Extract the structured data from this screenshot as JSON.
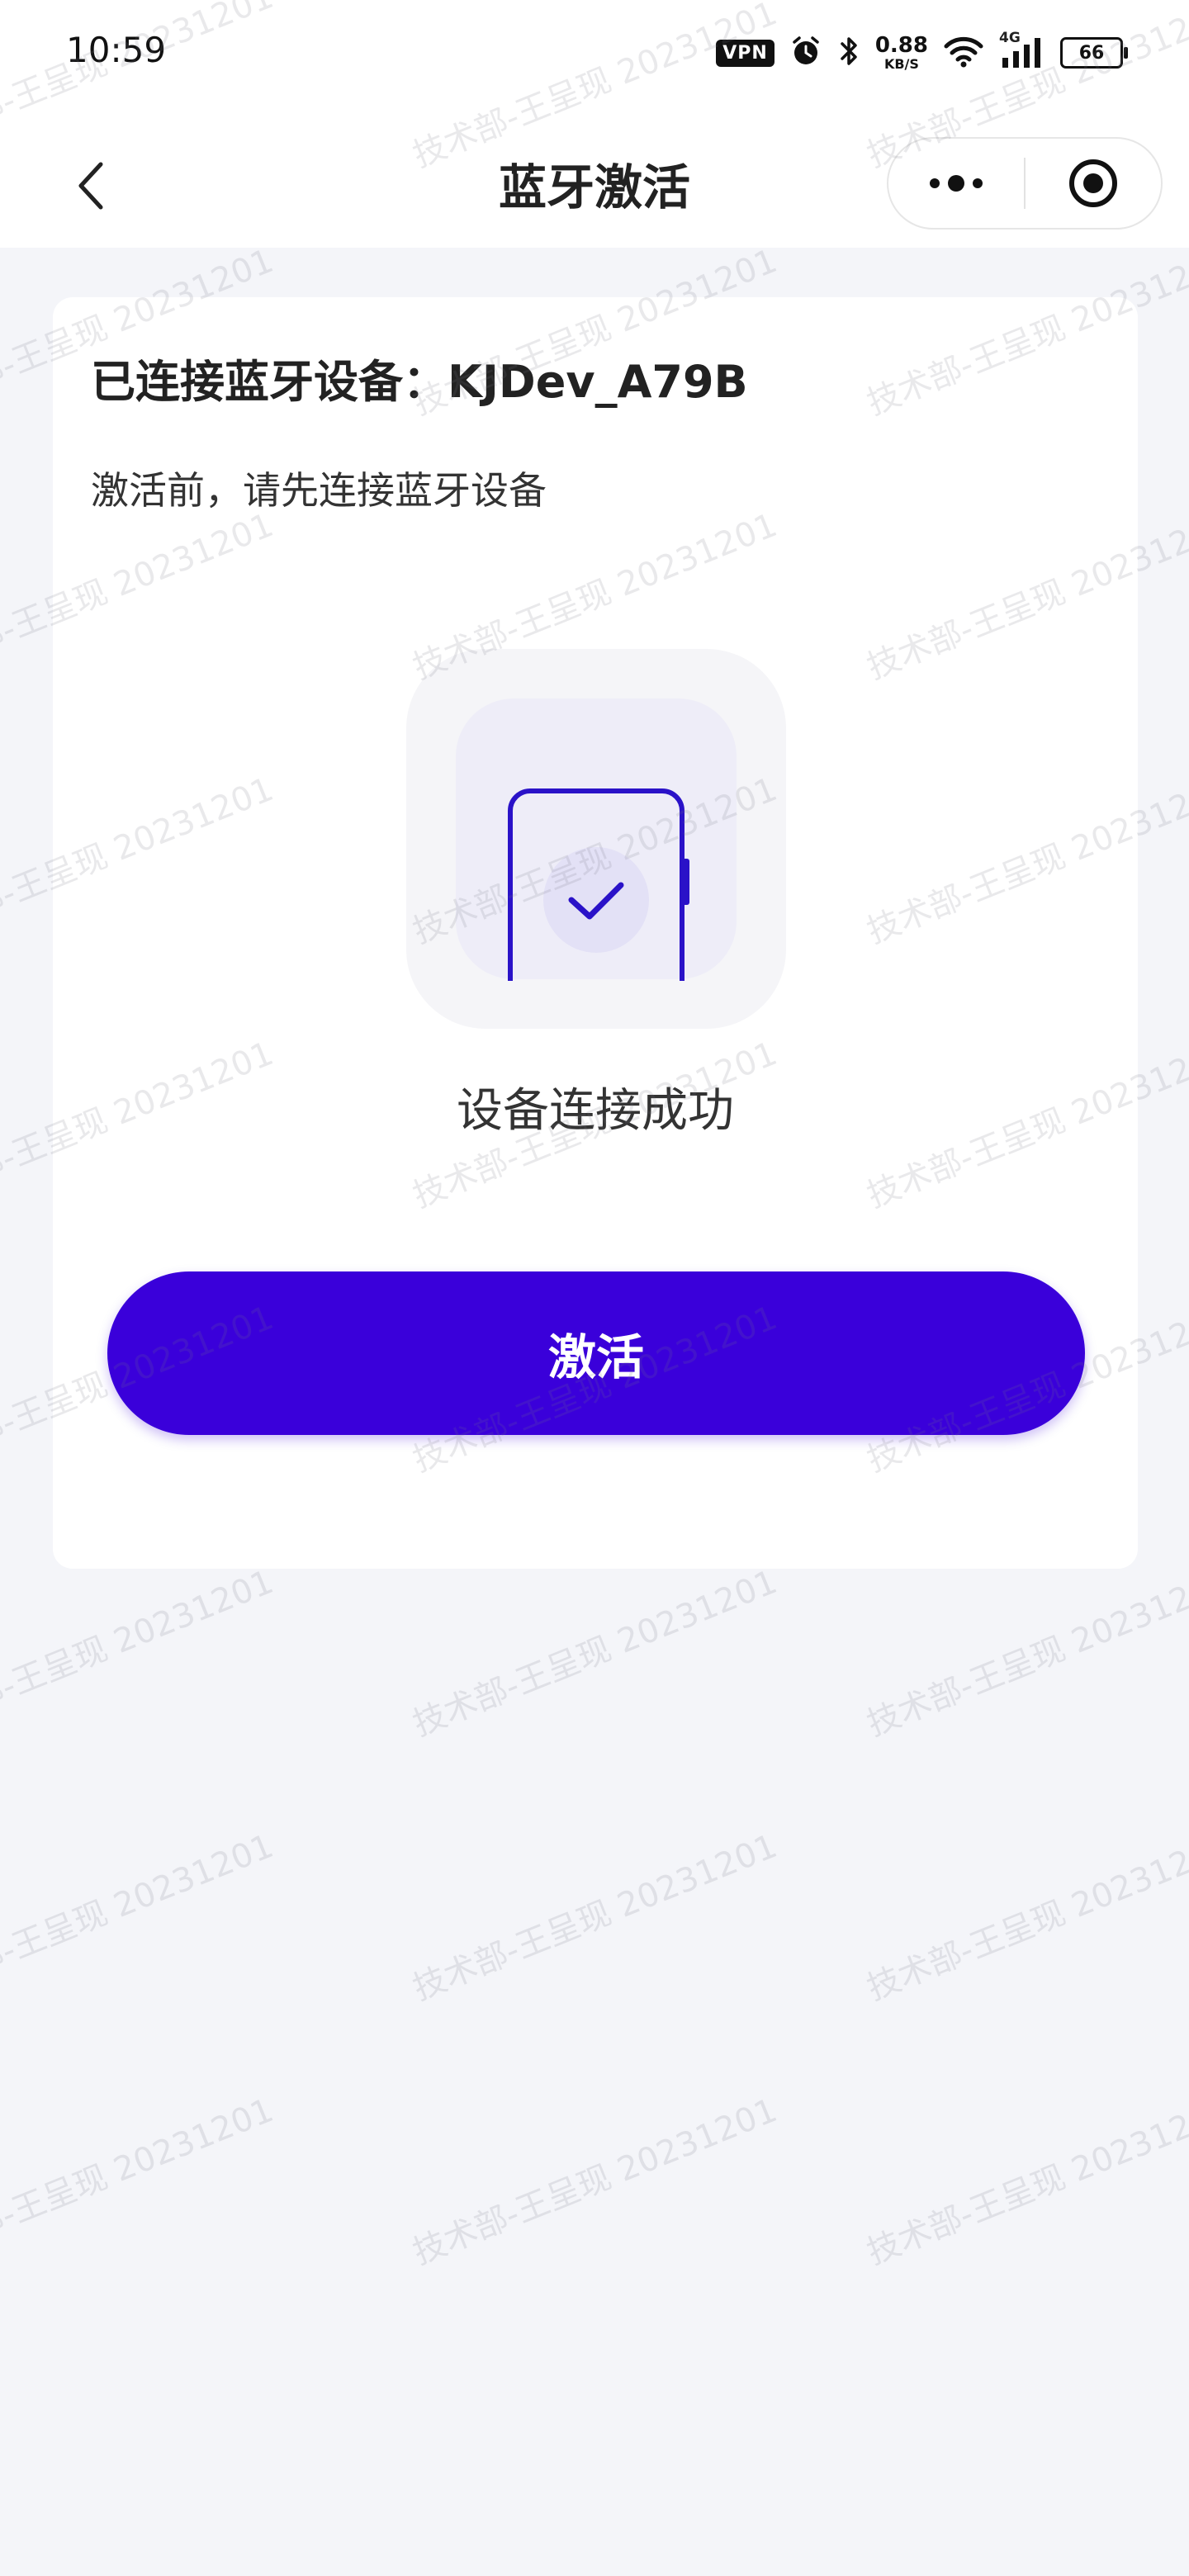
{
  "status_bar": {
    "time": "10:59",
    "vpn": "VPN",
    "net_speed_value": "0.88",
    "net_speed_unit": "KB/S",
    "network_type": "4G",
    "battery": "66",
    "icons": [
      "alarm-icon",
      "bluetooth-icon",
      "wifi-icon",
      "signal-icon"
    ]
  },
  "nav": {
    "title": "蓝牙激活",
    "back_icon": "chevron-left-icon",
    "more_icon": "more-dots-icon",
    "close_icon": "target-close-icon"
  },
  "card": {
    "device_line": "已连接蓝牙设备：KJDev_A79B",
    "hint": "激活前，请先连接蓝牙设备",
    "illustration_icon": "phone-check-icon",
    "status_text": "设备连接成功",
    "activate_label": "激活"
  },
  "watermark": {
    "text": "技术部-王呈现 20231201"
  },
  "colors": {
    "primary": "#3a00da",
    "page_background": "#f4f5f9",
    "card_background": "#ffffff",
    "illustration_stroke": "#2a12c8"
  }
}
